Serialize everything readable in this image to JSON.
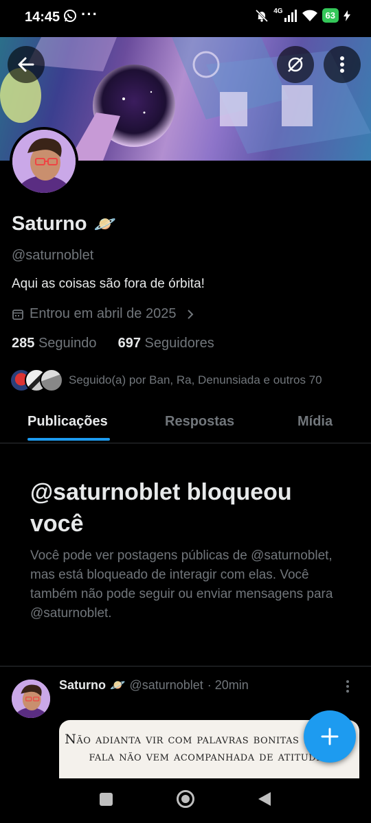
{
  "status_bar": {
    "time": "14:45",
    "dots": "···",
    "network": "4G",
    "battery": "63"
  },
  "profile": {
    "name": "Saturno",
    "name_emoji": "🪐",
    "handle": "@saturnoblet",
    "bio": "Aqui as coisas são fora de órbita!",
    "joined": "Entrou em abril de 2025",
    "following_count": "285",
    "following_label": "Seguindo",
    "followers_count": "697",
    "followers_label": "Seguidores",
    "followed_by": "Seguido(a) por Ban, Ra, Denunsiada e outros 70"
  },
  "tabs": [
    {
      "label": "Publicações",
      "active": true
    },
    {
      "label": "Respostas",
      "active": false
    },
    {
      "label": "Mídia",
      "active": false
    }
  ],
  "blocked": {
    "title": "@saturnoblet bloqueou você",
    "description": "Você pode ver postagens públicas de @saturnoblet, mas está bloqueado de interagir com elas. Você também não pode seguir ou enviar mensagens para @saturnoblet."
  },
  "post": {
    "author": "Saturno",
    "author_emoji": "🪐",
    "handle": "@saturnoblet",
    "time": "· 20min",
    "image_text": "Não adianta vir com palavras bonitas se a sua fala não vem acompanhada de atitudes"
  },
  "colors": {
    "accent": "#1d9bf0",
    "background": "#000000",
    "text_primary": "#e7e9ea",
    "text_secondary": "#71767b",
    "battery": "#34c759"
  },
  "icons": {
    "back": "arrow-left-icon",
    "grok": "grok-icon",
    "more": "more-vertical-icon",
    "calendar": "calendar-icon",
    "chevron": "chevron-right-icon",
    "compose": "plus-icon"
  }
}
